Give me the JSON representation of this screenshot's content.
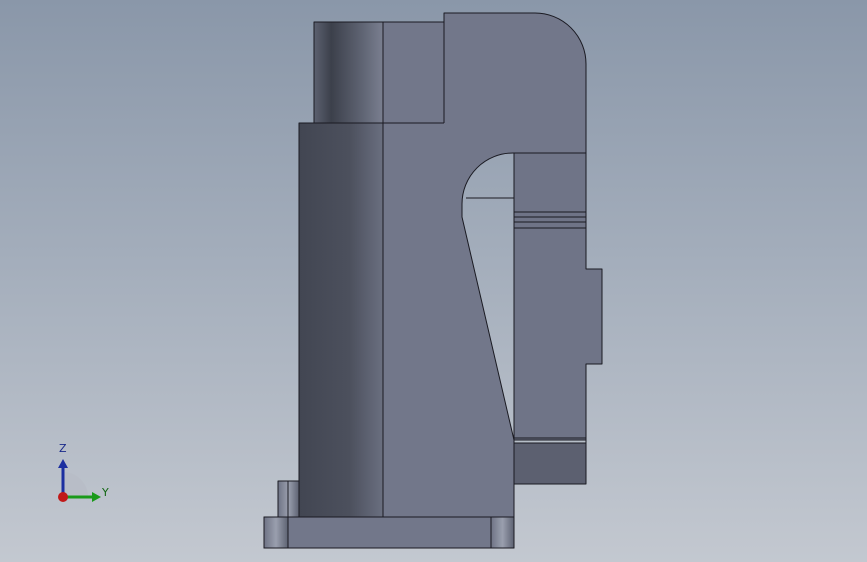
{
  "triad": {
    "z_label": "Z",
    "y_label": "Y",
    "colors": {
      "z_axis": "#1c2fa0",
      "y_axis": "#1a9a1a",
      "x_axis": "#c01818"
    }
  },
  "colors": {
    "background_top": "#8a97a9",
    "background_bottom": "#c3c8d0",
    "part_face": "#72778a",
    "part_dark": "#454a56",
    "edge": "#1a1a22"
  }
}
